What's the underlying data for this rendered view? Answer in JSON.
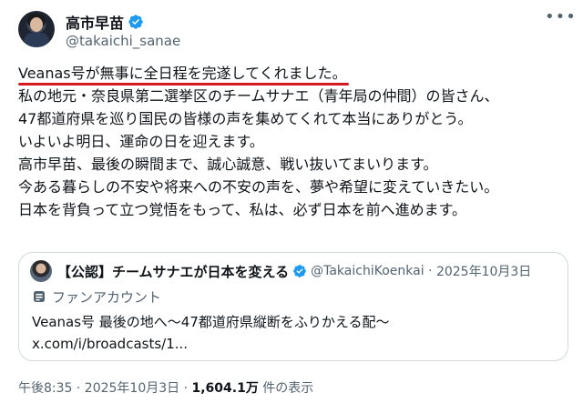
{
  "author": {
    "name": "高市早苗",
    "handle": "@takaichi_sanae"
  },
  "post": {
    "lines": [
      "Veanas号が無事に全日程を完遂してくれました。",
      "私の地元・奈良県第二選挙区のチームサナエ（青年局の仲間）の皆さん、",
      "47都道府県を巡り国民の皆様の声を集めてくれて本当にありがとう。",
      "いよいよ明日、運命の日を迎えます。",
      "高市早苗、最後の瞬間まで、誠心誠意、戦い抜いてまいります。",
      "今ある暮らしの不安や将来への不安の声を、夢や希望に変えていきたい。",
      "日本を背負って立つ覚悟をもって、私は、必ず日本を前へ進めます。"
    ]
  },
  "quote": {
    "name": "【公認】チームサナエが日本を変える",
    "handle": "@TakaichiKoenkai",
    "separator": " · ",
    "date": "2025年10月3日",
    "account_label": "ファンアカウント",
    "text_lines": [
      "Veanas号 最後の地へ〜47都道府県縦断をふりかえる配〜",
      "x.com/i/broadcasts/1..."
    ]
  },
  "footer": {
    "time_date": "午後8:35 · 2025年10月3日 · ",
    "views_count": "1,604.1万",
    "views_label": " 件の表示"
  },
  "colors": {
    "text": "#0f1419",
    "secondary": "#536471",
    "verified": "#1d9bf0",
    "highlight_underline": "#d41921",
    "border": "#cfd9de"
  },
  "icons": {
    "verified": "verified-badge-icon",
    "more": "more-options-icon",
    "fan_account": "fan-account-badge-icon"
  }
}
